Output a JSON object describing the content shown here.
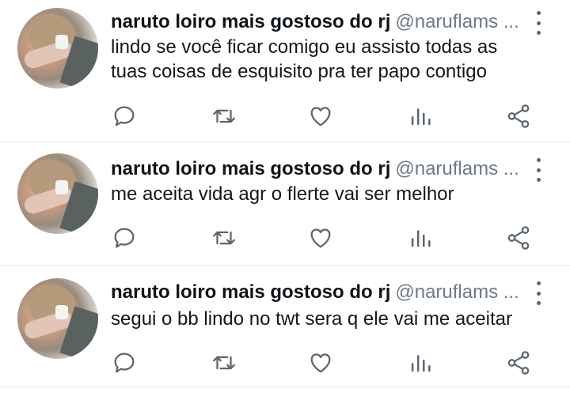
{
  "tweets": [
    {
      "author_name": "naruto loiro mais gostoso do rj",
      "author_handle": "@naruflams ...",
      "text": "lindo se você ficar comigo eu assisto todas as tuas coisas de esquisito pra ter papo contigo"
    },
    {
      "author_name": "naruto loiro mais gostoso do rj",
      "author_handle": "@naruflams ...",
      "text": "me aceita vida agr o flerte vai ser melhor"
    },
    {
      "author_name": "naruto loiro mais gostoso do rj",
      "author_handle": "@naruflams ...",
      "text": "segui o bb lindo no twt sera q ele vai me aceitar"
    }
  ],
  "icons": {
    "reply": "reply-icon",
    "retweet": "retweet-icon",
    "like": "heart-icon",
    "stats": "bar-chart-icon",
    "share": "share-icon",
    "more": "more-vertical-icon"
  },
  "colors": {
    "icon": "#5b6670",
    "handle": "#6e7a85",
    "divider": "#e6ecf0"
  }
}
